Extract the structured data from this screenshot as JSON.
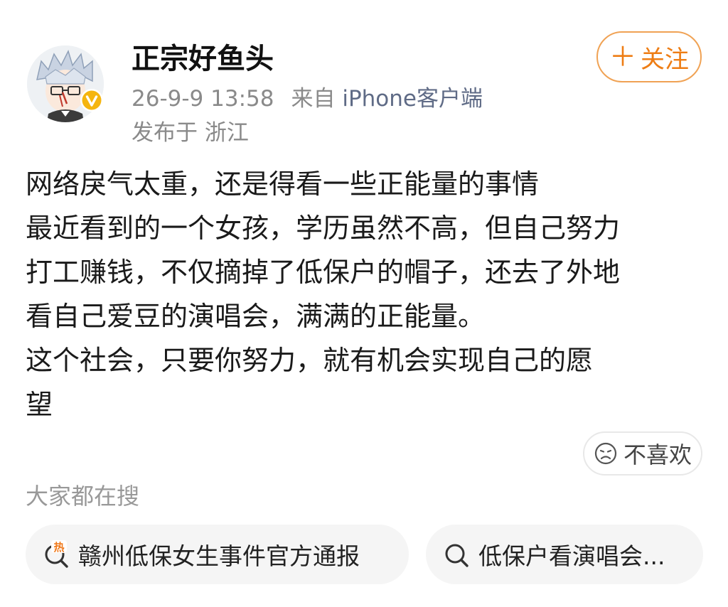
{
  "user": {
    "name": "正宗好鱼头"
  },
  "meta": {
    "time": "26-9-9 13:58",
    "from_label": "来自",
    "client": "iPhone客户端",
    "location": "发布于 浙江"
  },
  "follow_button": {
    "label": "关注",
    "icon": "plus-icon"
  },
  "post": {
    "lines": [
      "网络戾气太重，还是得看一些正能量的事情",
      "最近看到的一个女孩，学历虽然不高，但自己努力",
      "打工赚钱，不仅摘掉了低保户的帽子，还去了外地",
      "看自己爱豆的演唱会，满满的正能量。",
      "这个社会，只要你努力，就有机会实现自己的愿",
      "望"
    ]
  },
  "dislike_button": {
    "label": "不喜欢",
    "icon": "sad-face-icon"
  },
  "trending": {
    "title": "大家都在搜",
    "chips": [
      {
        "label": "赣州低保女生事件官方通报",
        "icon": "hot-search-icon",
        "badge": "热"
      },
      {
        "label": "低保户看演唱会...",
        "icon": "search-icon"
      }
    ]
  },
  "colors": {
    "accent_orange": "#ee7d14",
    "verified_gold": "#f5b50f",
    "meta_gray": "#8a8a8a"
  }
}
